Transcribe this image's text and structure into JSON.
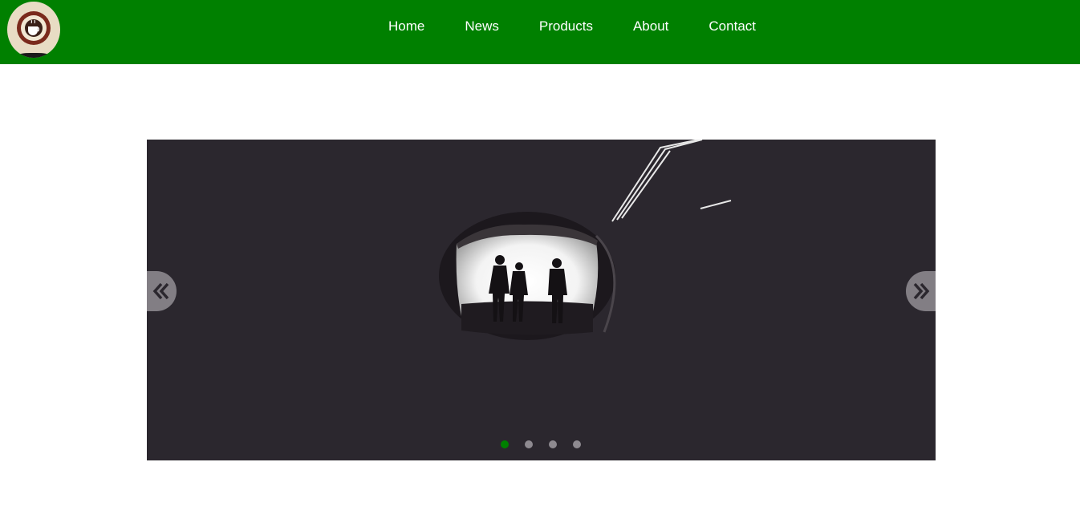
{
  "header": {
    "background_color": "#008000",
    "logo": {
      "icon": "coffee-cup-icon"
    },
    "nav": [
      {
        "label": "Home"
      },
      {
        "label": "News"
      },
      {
        "label": "Products"
      },
      {
        "label": "About"
      },
      {
        "label": "Contact"
      }
    ]
  },
  "slider": {
    "image_icon": "tunnel-silhouettes-photo",
    "prev_icon": "double-chevron-left-icon",
    "next_icon": "double-chevron-right-icon",
    "slide_count": 4,
    "active_index": 0,
    "active_dot_color": "#008000",
    "dot_color": "#8e8a90"
  }
}
